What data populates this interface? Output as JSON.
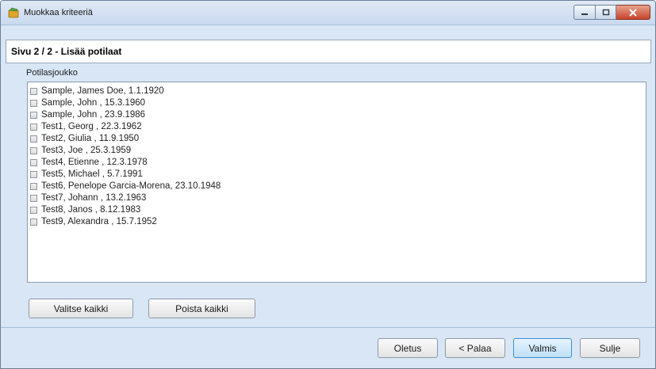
{
  "window": {
    "title": "Muokkaa kriteeriä",
    "colors": {
      "frame": "#d8e6f5",
      "title_bar": "#c9d9ee",
      "close": "#c7442a"
    }
  },
  "header": {
    "page_title": "Sivu 2 / 2 - Lisää potilaat"
  },
  "group": {
    "label": "Potilasjoukko",
    "patients": [
      {
        "label": "Sample, James Doe, 1.1.1920",
        "checked": false
      },
      {
        "label": "Sample, John , 15.3.1960",
        "checked": false
      },
      {
        "label": "Sample, John , 23.9.1986",
        "checked": false
      },
      {
        "label": "Test1, Georg , 22.3.1962",
        "checked": false
      },
      {
        "label": "Test2, Giulia , 11.9.1950",
        "checked": false
      },
      {
        "label": "Test3, Joe , 25.3.1959",
        "checked": false
      },
      {
        "label": "Test4, Etienne , 12.3.1978",
        "checked": false
      },
      {
        "label": "Test5, Michael , 5.7.1991",
        "checked": false
      },
      {
        "label": "Test6, Penelope Garcia-Morena, 23.10.1948",
        "checked": false
      },
      {
        "label": "Test7, Johann , 13.2.1963",
        "checked": false
      },
      {
        "label": "Test8, Janos , 8.12.1983",
        "checked": false
      },
      {
        "label": "Test9, Alexandra , 15.7.1952",
        "checked": false
      }
    ],
    "select_all_label": "Valitse kaikki",
    "clear_all_label": "Poista kaikki"
  },
  "footer": {
    "default_label": "Oletus",
    "back_label": "< Palaa",
    "finish_label": "Valmis",
    "close_label": "Sulje"
  }
}
